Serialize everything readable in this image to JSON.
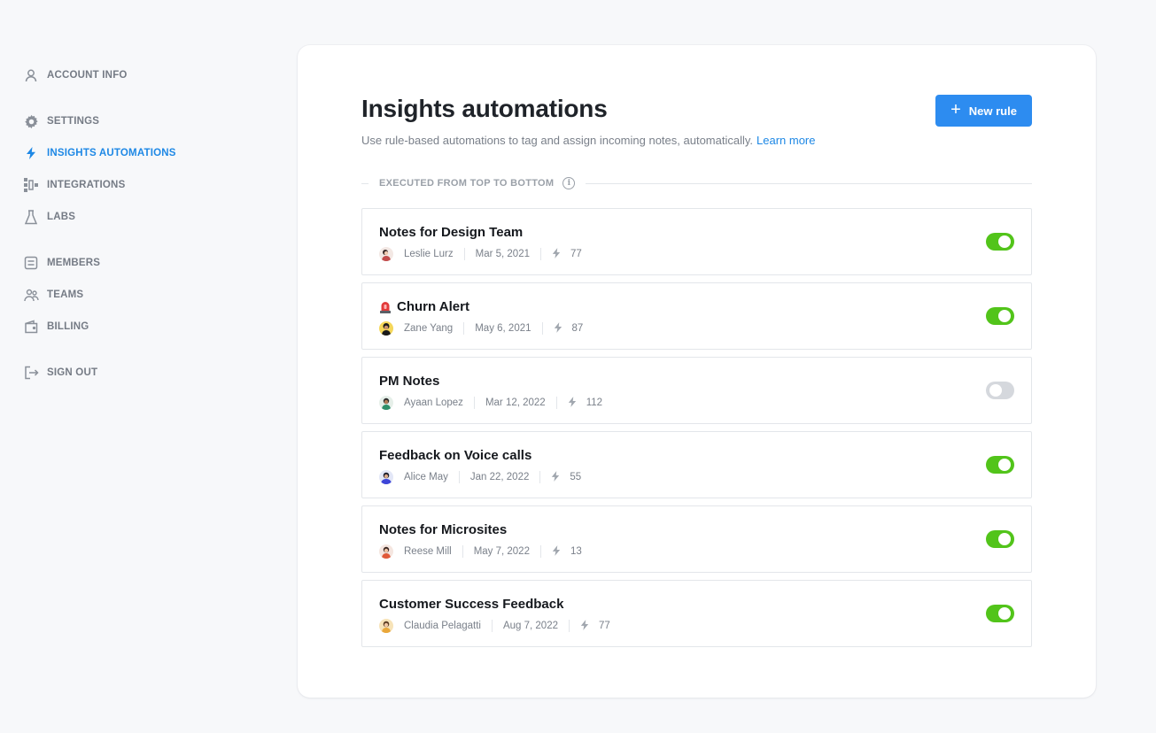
{
  "sidebar": {
    "items": [
      {
        "label": "ACCOUNT INFO",
        "icon": "user-icon"
      },
      {
        "label": "SETTINGS",
        "icon": "gear-icon"
      },
      {
        "label": "INSIGHTS AUTOMATIONS",
        "icon": "bolt-icon",
        "active": true
      },
      {
        "label": "INTEGRATIONS",
        "icon": "integrations-icon"
      },
      {
        "label": "LABS",
        "icon": "flask-icon"
      },
      {
        "label": "MEMBERS",
        "icon": "members-icon"
      },
      {
        "label": "TEAMS",
        "icon": "teams-icon"
      },
      {
        "label": "BILLING",
        "icon": "wallet-icon"
      },
      {
        "label": "SIGN OUT",
        "icon": "sign-out-icon"
      }
    ]
  },
  "header": {
    "title": "Insights automations",
    "subtitle": "Use rule-based automations to tag and assign incoming notes, automatically.",
    "learn_more": "Learn more",
    "new_rule_label": "New rule"
  },
  "section": {
    "label": "EXECUTED FROM TOP TO BOTTOM",
    "info": "i"
  },
  "rules": [
    {
      "title": "Notes for Design Team",
      "author": "Leslie Lurz",
      "date": "Mar 5, 2021",
      "count": "77",
      "enabled": true,
      "emoji": ""
    },
    {
      "title": "Churn Alert",
      "author": "Zane Yang",
      "date": "May 6, 2021",
      "count": "87",
      "enabled": true,
      "emoji": "siren-icon"
    },
    {
      "title": "PM Notes",
      "author": "Ayaan Lopez",
      "date": "Mar 12, 2022",
      "count": "112",
      "enabled": false,
      "emoji": ""
    },
    {
      "title": "Feedback on Voice calls",
      "author": "Alice May",
      "date": "Jan 22, 2022",
      "count": "55",
      "enabled": true,
      "emoji": ""
    },
    {
      "title": "Notes for Microsites",
      "author": "Reese Mill",
      "date": "May 7, 2022",
      "count": "13",
      "enabled": true,
      "emoji": ""
    },
    {
      "title": "Customer Success Feedback",
      "author": "Claudia Pelagatti",
      "date": "Aug 7, 2022",
      "count": "77",
      "enabled": true,
      "emoji": ""
    }
  ],
  "colors": {
    "accent": "#2d8cf0",
    "toggle_on": "#52c41a",
    "toggle_off": "#d5d8dd",
    "active_nav": "#1e88e5"
  }
}
